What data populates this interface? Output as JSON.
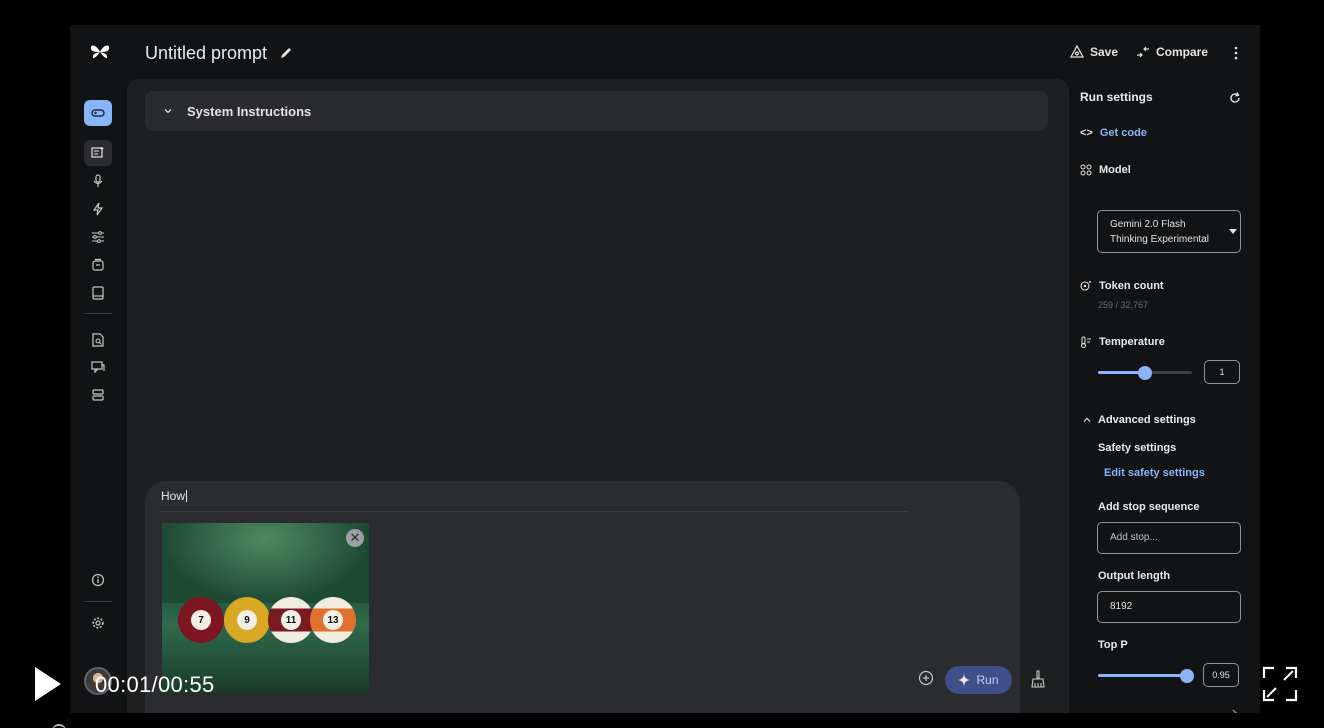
{
  "window": {
    "title": "Untitled prompt"
  },
  "header": {
    "save_label": "Save",
    "compare_label": "Compare"
  },
  "main": {
    "system_instructions_label": "System Instructions",
    "prompt_input_value": "How",
    "run_label": "Run",
    "attachment": {
      "balls": [
        "7",
        "9",
        "11",
        "13"
      ]
    }
  },
  "settings": {
    "title": "Run settings",
    "get_code_label": "Get code",
    "model_label": "Model",
    "model_value_line1": "Gemini 2.0 Flash",
    "model_value_line2": "Thinking Experimental",
    "token_count_label": "Token count",
    "token_count_value": "259 / 32,767",
    "temperature_label": "Temperature",
    "temperature_value": "1",
    "temperature_fraction": 0.5,
    "advanced_label": "Advanced settings",
    "safety_label": "Safety settings",
    "edit_safety_label": "Edit safety settings",
    "stop_sequence_label": "Add stop sequence",
    "stop_sequence_placeholder": "Add stop...",
    "output_length_label": "Output length",
    "output_length_value": "8192",
    "top_p_label": "Top P",
    "top_p_value": "0.95",
    "top_p_fraction": 0.95
  },
  "player": {
    "time": "00:01/00:55"
  },
  "colors": {
    "accent": "#8ab4f8",
    "run_bg": "#3f4f8a",
    "background": "#121314",
    "panel": "#1e1f21"
  }
}
